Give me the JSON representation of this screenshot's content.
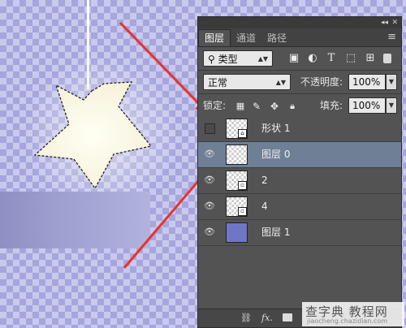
{
  "panel": {
    "tabs": [
      "图层",
      "通道",
      "路径"
    ],
    "filter": {
      "label": "类型"
    },
    "filter_icons": [
      "image-filter-icon",
      "adjustment-filter-icon",
      "type-filter-icon",
      "shape-filter-icon",
      "smart-object-filter-icon"
    ],
    "blend_mode": "正常",
    "opacity_label": "不透明度:",
    "opacity_value": "100%",
    "lock_label": "锁定:",
    "fill_label": "填充:",
    "fill_value": "100%",
    "layers": [
      {
        "name": "形状 1",
        "visible": false,
        "selected": false
      },
      {
        "name": "图层 0",
        "visible": true,
        "selected": true
      },
      {
        "name": "2",
        "visible": true,
        "selected": false
      },
      {
        "name": "4",
        "visible": true,
        "selected": false
      },
      {
        "name": "图层 1",
        "visible": true,
        "selected": false
      }
    ],
    "bottom_icons": [
      "link-icon",
      "fx-icon",
      "mask-icon"
    ]
  },
  "watermark": {
    "main": "查字典 教程网",
    "sub": "jiaocheng.chazidian.com"
  },
  "colors": {
    "accent_arrow": "#e8332b",
    "canvas_checker": "#a6a6dc",
    "panel_bg": "#535353",
    "selected_layer": "#6e7f96"
  }
}
